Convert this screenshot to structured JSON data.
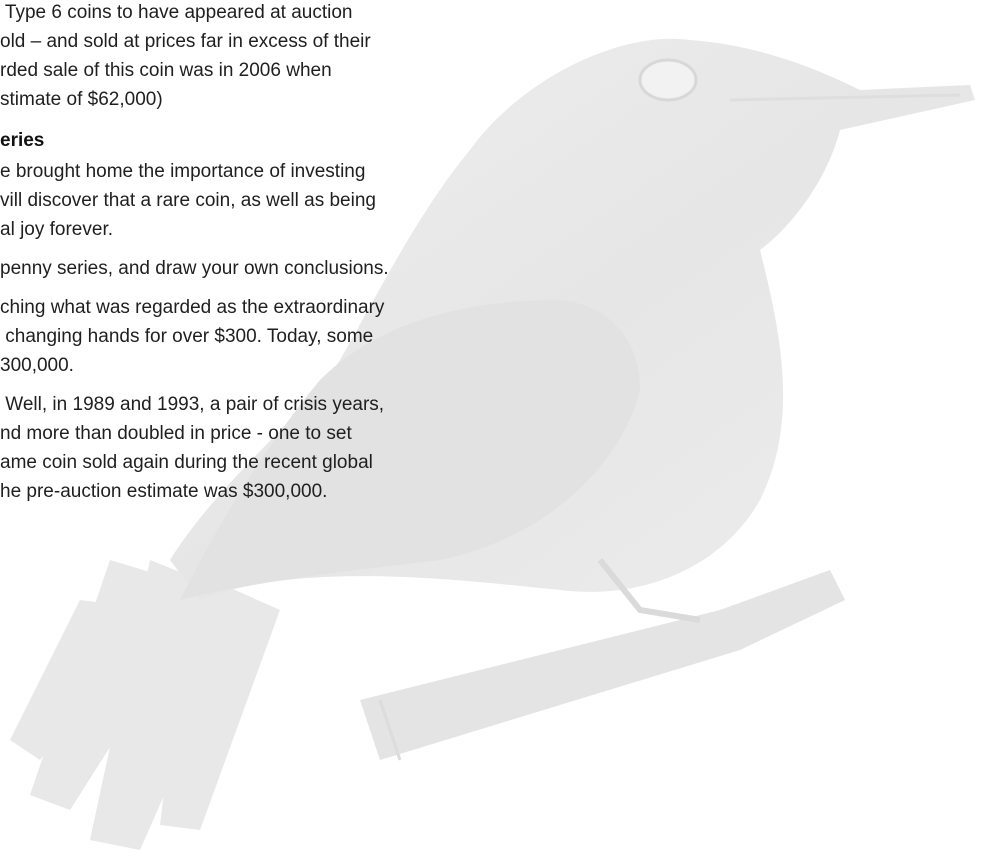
{
  "paragraph_1": {
    "line_1": " Type 6 coins to have appeared at auction",
    "line_2": "old – and sold at prices far in excess of their",
    "line_3": "rded sale of this coin was in 2006 when",
    "line_4": "stimate of $62,000)"
  },
  "section_heading": "eries",
  "paragraph_2": {
    "line_1": "e brought home the importance of investing",
    "line_2": "vill discover that a rare coin, as well as being",
    "line_3": "al joy forever."
  },
  "paragraph_3": {
    "line_1": "penny series, and draw your own conclusions."
  },
  "paragraph_4": {
    "line_1": "ching what was regarded as the extraordinary",
    "line_2": " changing hands for over $300. Today, some",
    "line_3": "300,000."
  },
  "paragraph_5": {
    "line_1": " Well, in 1989 and 1993, a pair of crisis years,",
    "line_2": "nd more than doubled in price - one to set",
    "line_3": "ame coin sold again during the recent global",
    "line_4": "he pre-auction estimate was $300,000."
  },
  "colors": {
    "text": "#1f1f1f",
    "watermark": "#e9e9e9",
    "background": "#ffffff"
  },
  "watermark": {
    "icon": "kookaburra-watermark-icon"
  }
}
